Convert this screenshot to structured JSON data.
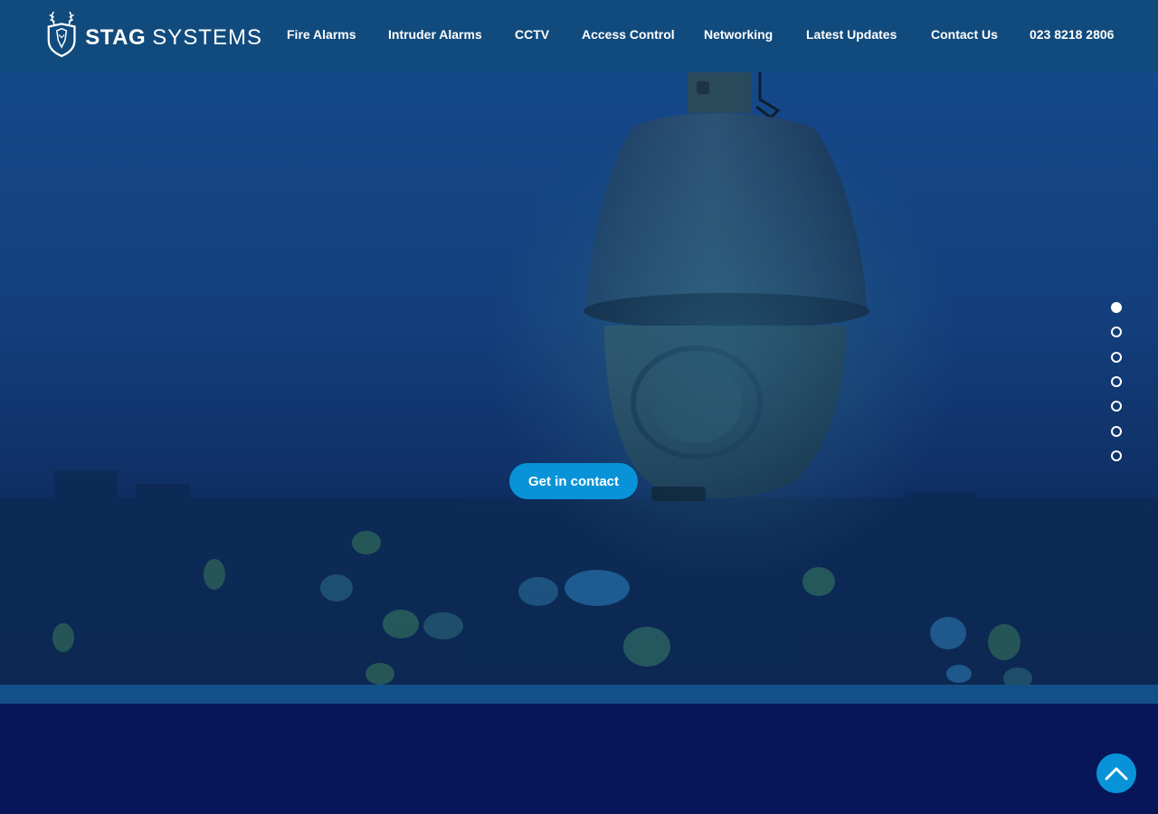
{
  "brand": {
    "name_bold": "STAG",
    "name_light": "SYSTEMS",
    "logo_icon": "stag-shield-icon"
  },
  "nav": {
    "items": [
      {
        "label": "Fire Alarms"
      },
      {
        "label": "Intruder Alarms"
      },
      {
        "label": "CCTV"
      },
      {
        "label": "Access Control"
      },
      {
        "label": "Networking"
      },
      {
        "label": "Latest Updates"
      },
      {
        "label": "Contact Us"
      },
      {
        "label": "023 8218 2806"
      }
    ]
  },
  "hero": {
    "cta_label": "Get in contact",
    "image": "cctv-dome-camera-city-night"
  },
  "slider": {
    "count": 7,
    "active_index": 0
  },
  "back_to_top": {
    "icon": "chevron-up-icon"
  },
  "colors": {
    "header": "#114b7d",
    "accent": "#0893d8",
    "footer": "#071559",
    "strip": "#13508a"
  }
}
